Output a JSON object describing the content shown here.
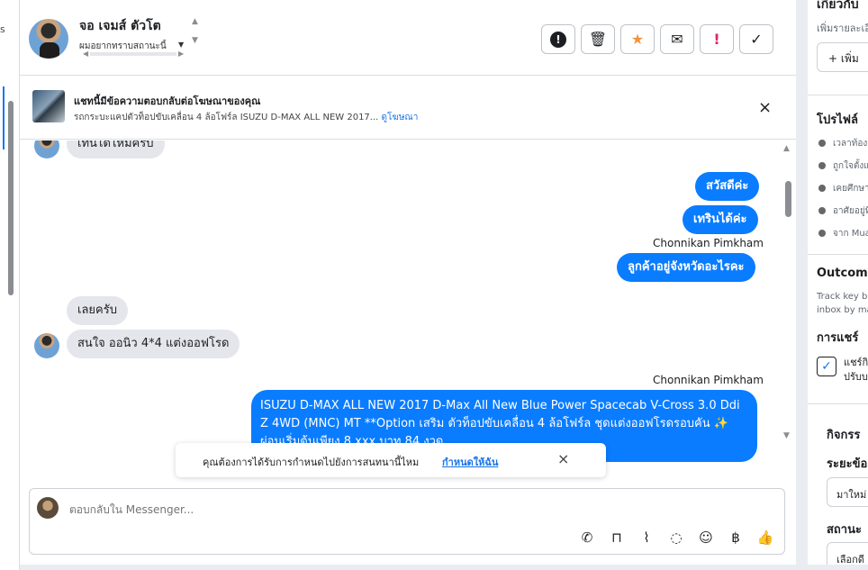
{
  "left_strip": {
    "glyph": "s"
  },
  "header": {
    "contact_name": "จอ เจมส์ ตัวโต",
    "contact_sub": "ผมอยากทราบสถานะนี้",
    "actions": [
      {
        "name": "report-button",
        "icon": "exclamation-circle-icon",
        "glyph": "!"
      },
      {
        "name": "delete-button",
        "icon": "trash-icon",
        "glyph": "🗑"
      },
      {
        "name": "star-button",
        "icon": "star-icon",
        "glyph": "★"
      },
      {
        "name": "spam-button",
        "icon": "envelope-x-icon",
        "glyph": "✉"
      },
      {
        "name": "flag-button",
        "icon": "exclamation-icon",
        "glyph": "!"
      },
      {
        "name": "done-button",
        "icon": "check-icon",
        "glyph": "✓"
      }
    ]
  },
  "ad_banner": {
    "title": "แชทนี้มีข้อความตอบกลับต่อโฆษณาของคุณ",
    "description": "รถกระบะแคปตัวท็อปขับเคลื่อน 4 ล้อโฟร์ล ISUZU D-MAX ALL NEW 2017...",
    "link": "ดูโฆษณา",
    "close": "×"
  },
  "messages": {
    "in_1": "เทนไดไหมครับ",
    "out_1": "สวัสดีค่ะ",
    "out_2": "เทรินได้ค่ะ",
    "sender_1": "Chonnikan Pimkham",
    "out_3": "ลูกค้าอยู่จังหวัดอะไรคะ",
    "in_2": "เลยครับ",
    "in_3": "สนใจ ออนิว 4*4 แต่งออฟโรด",
    "sender_2": "Chonnikan Pimkham",
    "out_long": "ISUZU D-MAX ALL NEW 2017 D-Max All New Blue Power Spacecab V-Cross 3.0 Ddi Z 4WD (MNC) MT **Option เสริม ตัวท็อปขับเคลื่อน 4 ล้อโฟร์ล ชุดแต่งออฟโรดรอบคัน ✨ ผ่อนเริ่มต้นเพียง 8,xxx บาท 84 งวด"
  },
  "toast": {
    "text": "คุณต้องการได้รับการกำหนดไปยังการสนทนานี้ไหม",
    "link": "กำหนดให้ฉัน",
    "close": "×"
  },
  "composer": {
    "placeholder": "ตอบกลับใน Messenger...",
    "icons": [
      "phone-plus-icon",
      "bag-icon",
      "paperclip-icon",
      "chat-bubble-icon",
      "emoji-icon",
      "baht-icon",
      "thumbs-up-icon"
    ]
  },
  "right_panel": {
    "title": "เกี่ยวกับ",
    "subtitle": "เพิ่มรายละเอียด",
    "add_button": "+ เพิ่ม",
    "profile_heading": "โปรไฟล์",
    "profile_rows": [
      "เวลาท้องถิ่น",
      "ถูกใจตั้งแต่",
      "เคยศึกษา",
      "อาศัยอยู่ที่",
      "จาก Mua"
    ],
    "outcome_heading": "Outcome",
    "outcome_text_1": "Track key bu",
    "outcome_text_2": "inbox by ma",
    "share_heading": "การแชร์",
    "share_check_1": "แชร์กิ",
    "share_check_2": "ปรับบ",
    "activity_heading": "กิจกรร",
    "stage_label": "ระยะข้อ",
    "stage_value": "มาใหม่",
    "status_label": "สถานะ",
    "status_value": "เลือกดี"
  }
}
